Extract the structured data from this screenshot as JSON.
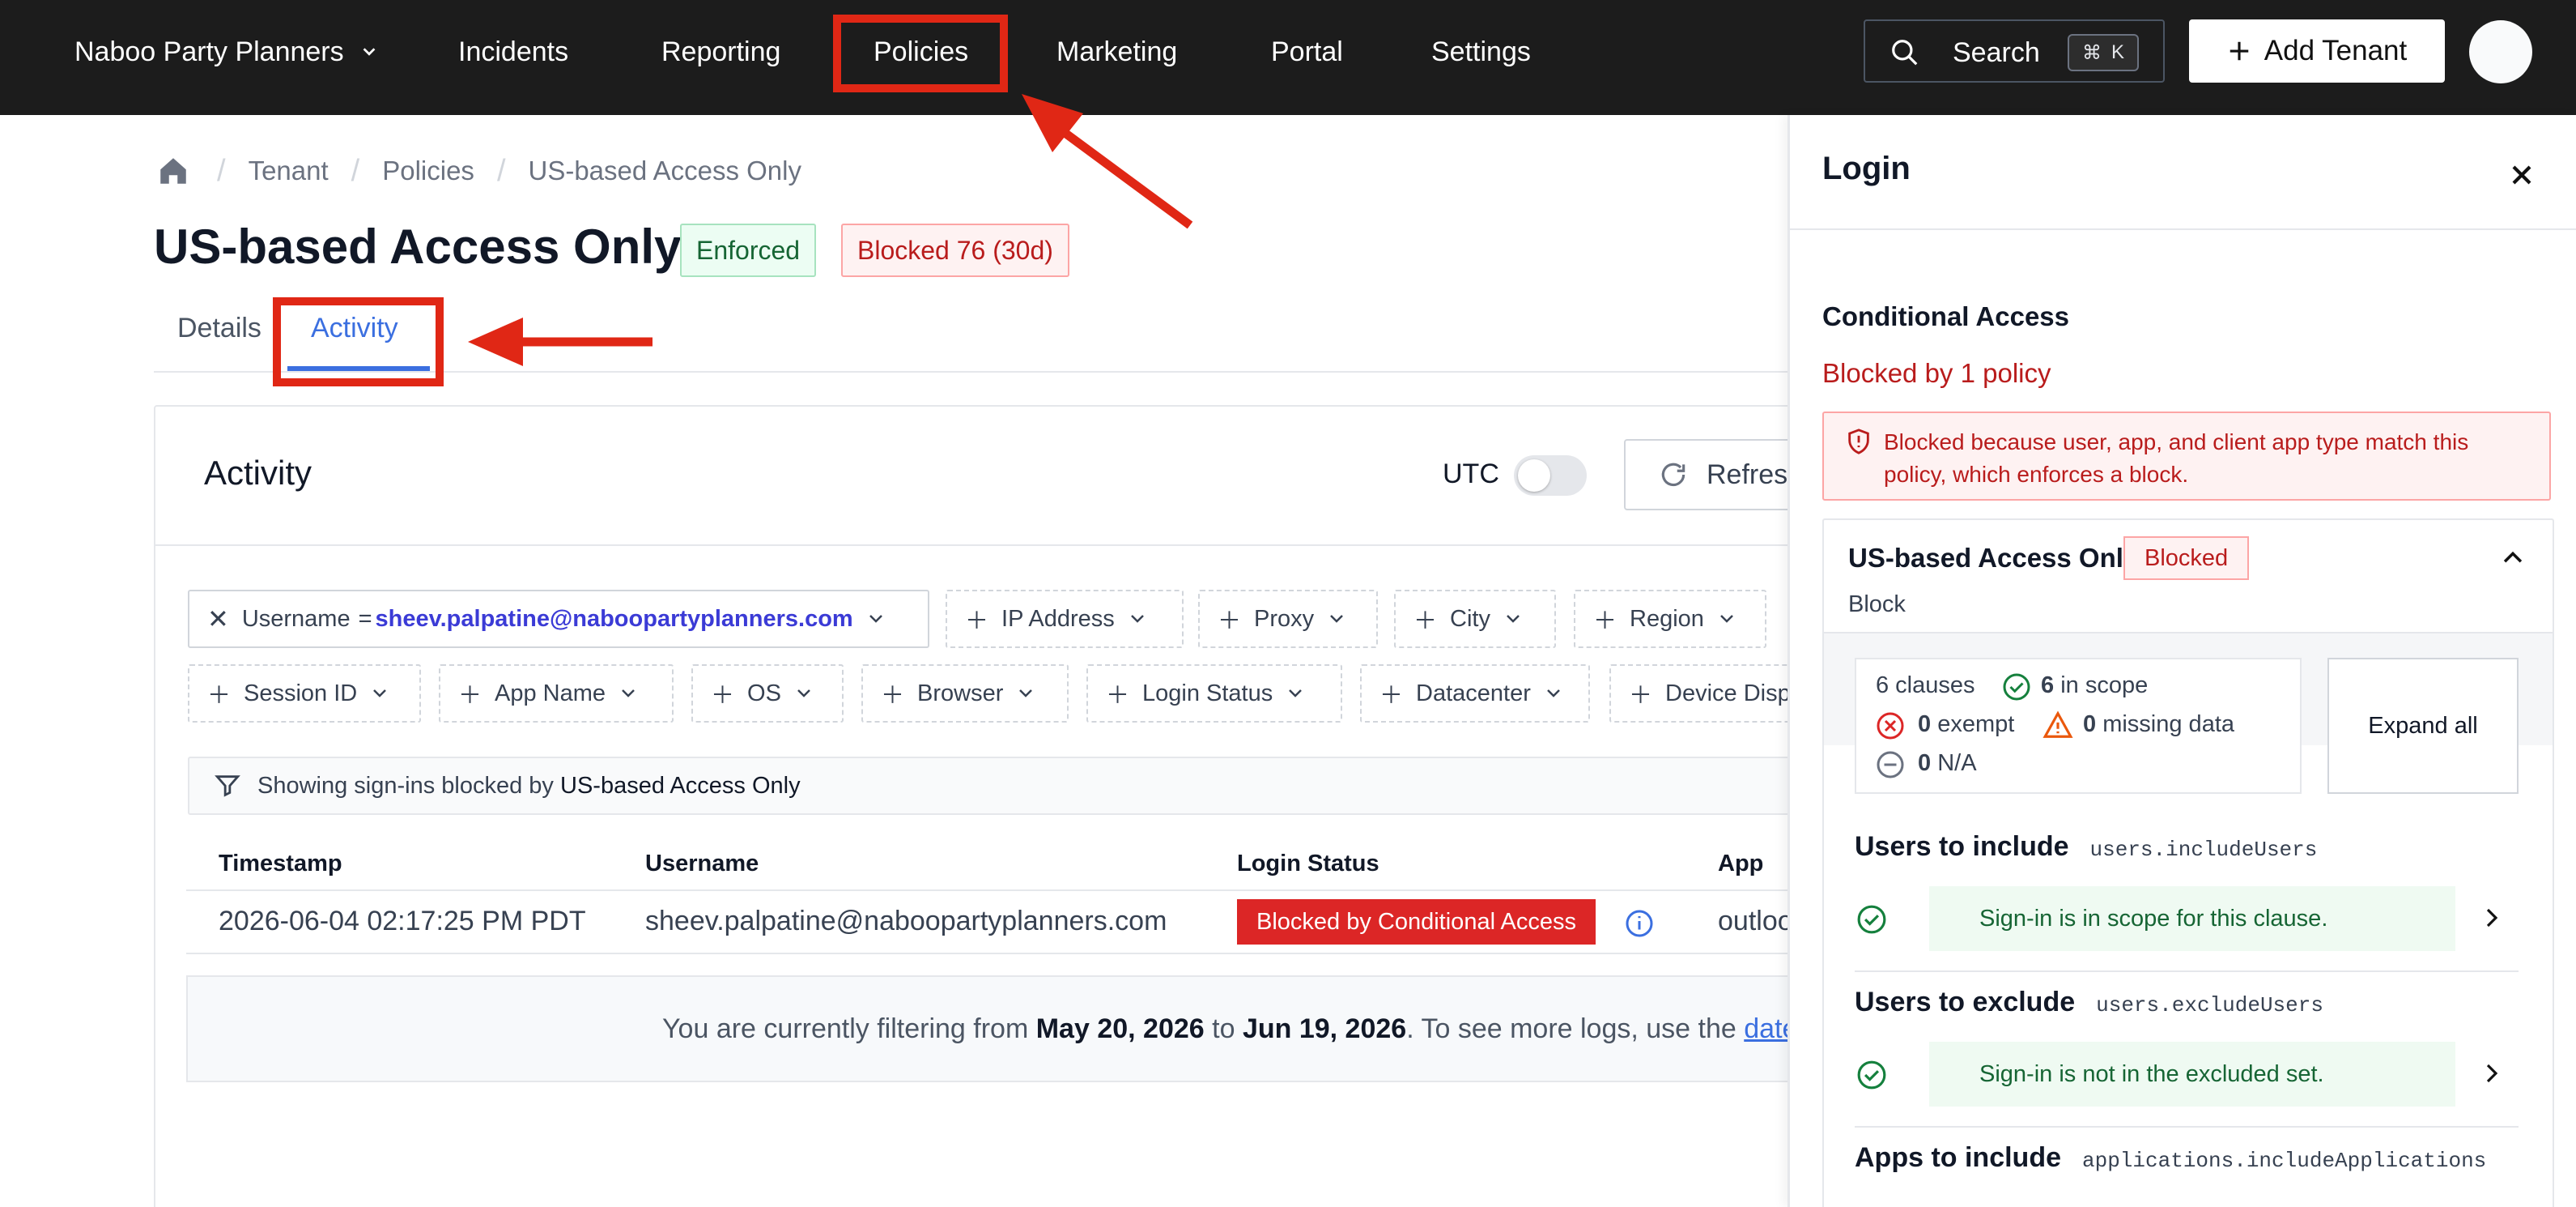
{
  "topbar": {
    "org_name": "Naboo Party Planners",
    "nav": [
      "Incidents",
      "Reporting",
      "Policies",
      "Marketing",
      "Portal",
      "Settings"
    ],
    "search_label": "Search",
    "search_kbd_mod": "⌘",
    "search_kbd_key": "K",
    "add_tenant_label": "Add Tenant"
  },
  "breadcrumb": [
    "Tenant",
    "Policies",
    "US-based Access Only"
  ],
  "page": {
    "title": "US-based Access Only",
    "status_badge": "Enforced",
    "blocked_badge": "Blocked 76 (30d)",
    "tabs": [
      "Details",
      "Activity"
    ],
    "active_tab": "Activity"
  },
  "activity": {
    "heading": "Activity",
    "utc_label": "UTC",
    "refresh_label": "Refresh",
    "filters_row1": {
      "username_key": "Username",
      "username_op": "=",
      "username_value": "sheev.palpatine@naboopartyplanners.com",
      "others": [
        "IP Address",
        "Proxy",
        "City",
        "Region"
      ]
    },
    "filters_row2": [
      "Session ID",
      "App Name",
      "OS",
      "Browser",
      "Login Status",
      "Datacenter",
      "Device Display"
    ],
    "showing_prefix": "Showing sign-ins blocked by",
    "showing_policy": "US-based Access Only",
    "table": {
      "columns": [
        "Timestamp",
        "Username",
        "Login Status",
        "App"
      ],
      "rows": [
        {
          "timestamp": "2026-06-04 02:17:25 PM PDT",
          "username": "sheev.palpatine@naboopartyplanners.com",
          "status": "Blocked by Conditional Access",
          "app": "outlook"
        }
      ]
    },
    "notice": {
      "prefix": "You are currently filtering from",
      "from": "May 20, 2026",
      "to_word": "to",
      "to": "Jun 19, 2026",
      "suffix": ". To see more logs, use the",
      "link": "date"
    }
  },
  "panel": {
    "title": "Login",
    "section": "Conditional Access",
    "blocked_by": "Blocked by 1 policy",
    "alert": "Blocked because user, app, and client app type match this policy, which enforces a block.",
    "policy_name": "US-based Access Only",
    "policy_badge": "Blocked",
    "policy_action": "Block",
    "stats": {
      "clauses": "6 clauses",
      "in_scope_num": "6",
      "in_scope_label": "in scope",
      "exempt_num": "0",
      "exempt_label": "exempt",
      "missing_num": "0",
      "missing_label": "missing data",
      "na_num": "0",
      "na_label": "N/A"
    },
    "expand_all": "Expand all",
    "clauses": [
      {
        "title": "Users to include",
        "field": "users.includeUsers",
        "message": "Sign-in is in scope for this clause."
      },
      {
        "title": "Users to exclude",
        "field": "users.excludeUsers",
        "message": "Sign-in is not in the excluded set."
      },
      {
        "title": "Apps to include",
        "field": "applications.includeApplications"
      }
    ]
  },
  "colors": {
    "topbar_bg": "#1c1c1c",
    "accent_blue": "#3b6fe0",
    "danger_red": "#dc2626",
    "success_green": "#166534",
    "annotation_red": "#e02715"
  }
}
